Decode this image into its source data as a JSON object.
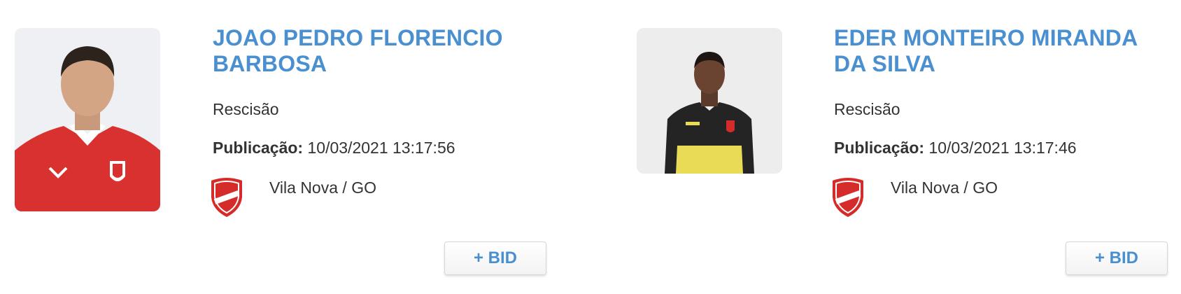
{
  "cards": [
    {
      "name": "JOAO PEDRO FLORENCIO BARBOSA",
      "status": "Rescisão",
      "publication_label": "Publicação:",
      "publication_date": "10/03/2021 13:17:56",
      "club": "Vila Nova / GO",
      "bid_label": "+ BID"
    },
    {
      "name": "EDER MONTEIRO MIRANDA DA SILVA",
      "status": "Rescisão",
      "publication_label": "Publicação:",
      "publication_date": "10/03/2021 13:17:46",
      "club": "Vila Nova / GO",
      "bid_label": "+ BID"
    }
  ],
  "colors": {
    "name_accent": "#4a90d0",
    "club_red": "#d62b2b"
  }
}
